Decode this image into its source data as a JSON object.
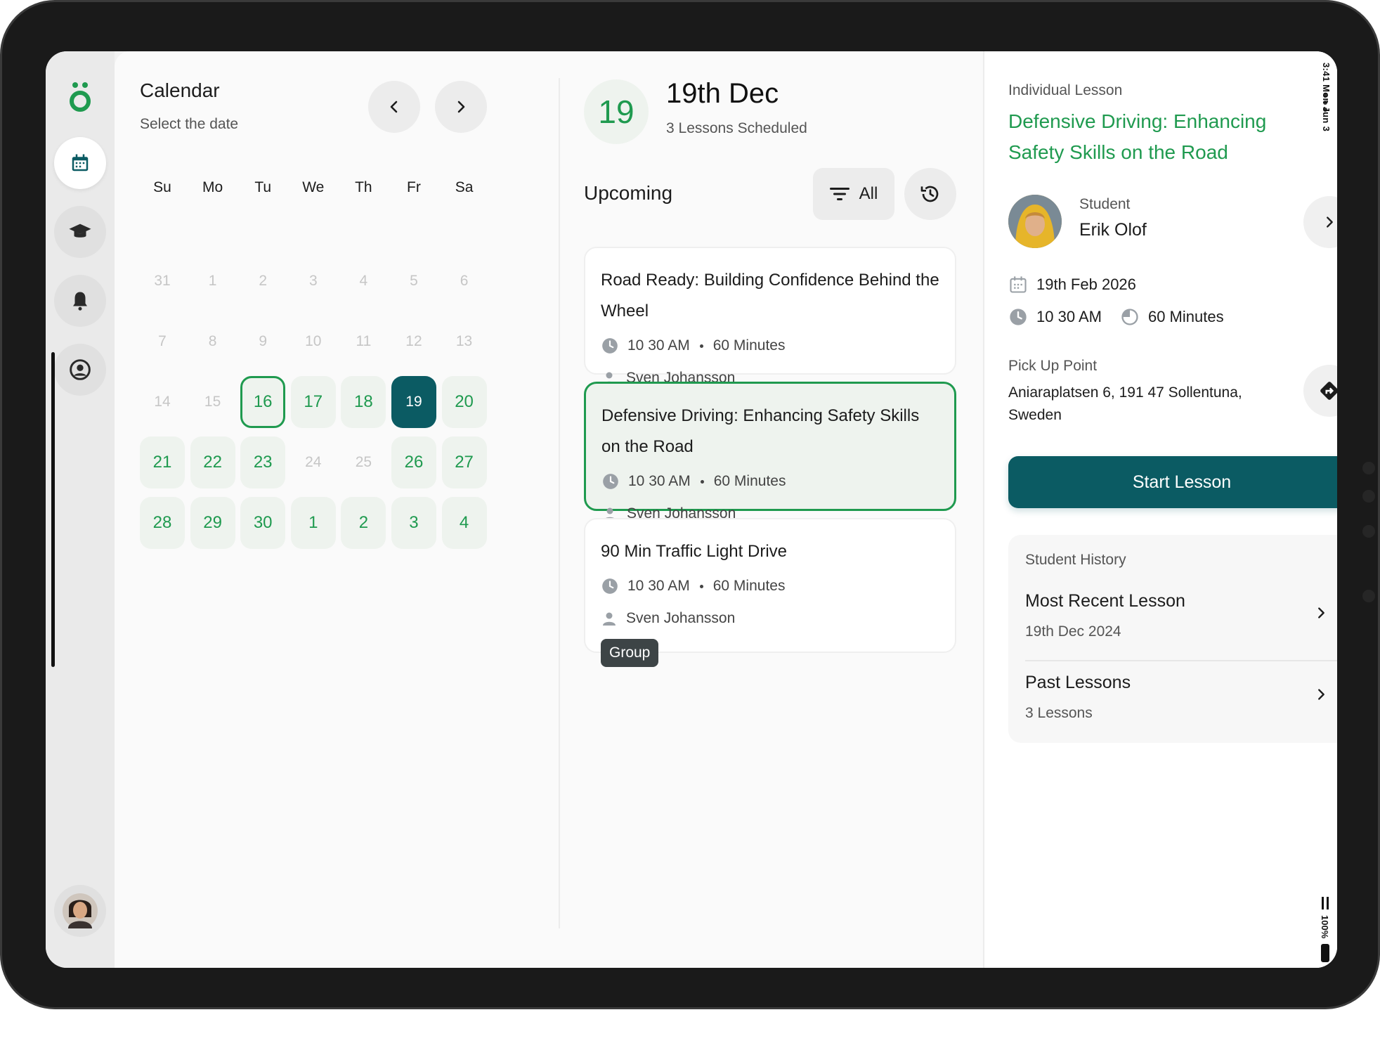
{
  "status_bar": {
    "time": "3:41 Mon Jun 3",
    "battery": "100%"
  },
  "rail": {
    "items": [
      {
        "icon": "calendar-icon",
        "active": true
      },
      {
        "icon": "graduation-cap-icon",
        "active": false
      },
      {
        "icon": "bell-icon",
        "active": false
      },
      {
        "icon": "user-circle-icon",
        "active": false
      }
    ]
  },
  "calendar": {
    "title": "Calendar",
    "subtitle": "Select the date",
    "weekdays": [
      "Su",
      "Mo",
      "Tu",
      "We",
      "Th",
      "Fr",
      "Sa"
    ],
    "days": [
      {
        "label": "31",
        "state": "muted"
      },
      {
        "label": "1",
        "state": "muted"
      },
      {
        "label": "2",
        "state": "muted"
      },
      {
        "label": "3",
        "state": "muted"
      },
      {
        "label": "4",
        "state": "muted"
      },
      {
        "label": "5",
        "state": "muted"
      },
      {
        "label": "6",
        "state": "muted"
      },
      {
        "label": "7",
        "state": "muted"
      },
      {
        "label": "8",
        "state": "muted"
      },
      {
        "label": "9",
        "state": "muted"
      },
      {
        "label": "10",
        "state": "muted"
      },
      {
        "label": "11",
        "state": "muted"
      },
      {
        "label": "12",
        "state": "muted"
      },
      {
        "label": "13",
        "state": "muted"
      },
      {
        "label": "14",
        "state": "muted"
      },
      {
        "label": "15",
        "state": "muted"
      },
      {
        "label": "16",
        "state": "today"
      },
      {
        "label": "17",
        "state": "avail"
      },
      {
        "label": "18",
        "state": "avail"
      },
      {
        "label": "19",
        "state": "selected"
      },
      {
        "label": "20",
        "state": "avail"
      },
      {
        "label": "21",
        "state": "avail"
      },
      {
        "label": "22",
        "state": "avail"
      },
      {
        "label": "23",
        "state": "avail"
      },
      {
        "label": "24",
        "state": "muted"
      },
      {
        "label": "25",
        "state": "muted"
      },
      {
        "label": "26",
        "state": "avail"
      },
      {
        "label": "27",
        "state": "avail"
      },
      {
        "label": "28",
        "state": "avail"
      },
      {
        "label": "29",
        "state": "avail"
      },
      {
        "label": "30",
        "state": "avail"
      },
      {
        "label": "1",
        "state": "avail"
      },
      {
        "label": "2",
        "state": "avail"
      },
      {
        "label": "3",
        "state": "avail"
      },
      {
        "label": "4",
        "state": "avail"
      }
    ]
  },
  "schedule": {
    "day_number": "19",
    "date": "19th Dec",
    "count": "3 Lessons Scheduled",
    "upcoming": "Upcoming",
    "filter_label": "All",
    "lessons": [
      {
        "title": "Road Ready: Building Confidence Behind the Wheel",
        "time": "10 30 AM",
        "duration": "60 Minutes",
        "instructor": "Sven Johansson",
        "tag": ""
      },
      {
        "title": "Defensive Driving: Enhancing Safety Skills on the Road",
        "time": "10 30 AM",
        "duration": "60 Minutes",
        "instructor": "Sven Johansson",
        "tag": ""
      },
      {
        "title": "90 Min Traffic Light Drive",
        "time": "10 30 AM",
        "duration": "60 Minutes",
        "instructor": "Sven Johansson",
        "tag": "Group"
      }
    ]
  },
  "detail": {
    "kind": "Individual Lesson",
    "title": "Defensive Driving: Enhancing Safety Skills on the Road",
    "student_label": "Student",
    "student_name": "Erik Olof",
    "date": "19th Feb 2026",
    "time": "10 30 AM",
    "duration": "60 Minutes",
    "pickup_label": "Pick Up Point",
    "pickup_address": "Aniaraplatsen 6, 191 47 Sollentuna, Sweden",
    "start_label": "Start Lesson",
    "history": {
      "title": "Student History",
      "recent_title": "Most Recent Lesson",
      "recent_date": "19th Dec 2024",
      "past_title": "Past Lessons",
      "past_count": "3 Lessons"
    }
  },
  "colors": {
    "accent": "#1f9a4f",
    "primary": "#0b5b63",
    "tint": "#eef3ee"
  }
}
